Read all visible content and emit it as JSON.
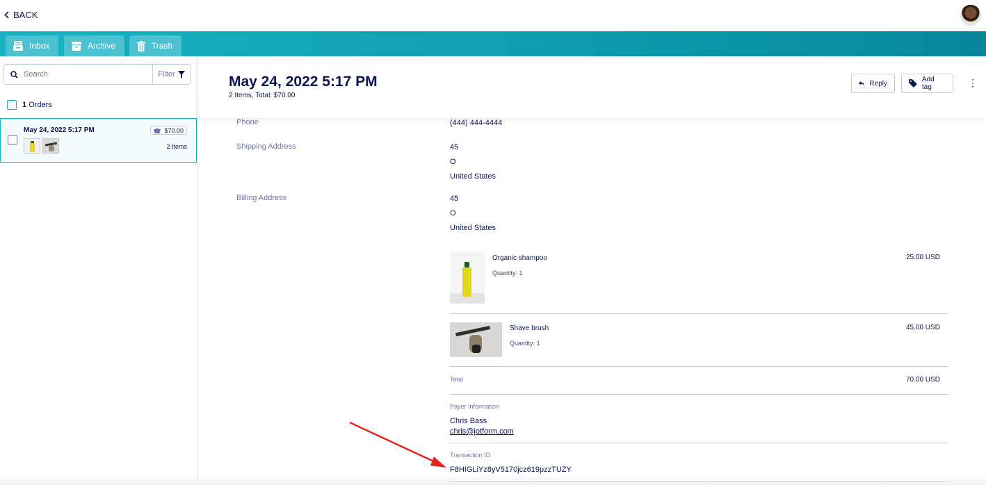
{
  "topbar": {
    "back_label": "BACK"
  },
  "tabs": [
    {
      "label": "Inbox"
    },
    {
      "label": "Archive"
    },
    {
      "label": "Trash"
    }
  ],
  "sidebar": {
    "search_placeholder": "Search",
    "filter_label": "Filter",
    "orders_count": "1",
    "orders_label": "Orders",
    "order": {
      "date": "May 24, 2022 5:17 PM",
      "price": "$70.00",
      "items": "2 Items"
    }
  },
  "header": {
    "title": "May 24, 2022 5:17 PM",
    "subtitle": "2 Items, Total: $70.00",
    "reply_label": "Reply",
    "add_tag_label": "Add tag",
    "more_label": "⋮"
  },
  "details": {
    "phone_label": "Phone",
    "phone_value": "(444) 444-4444",
    "shipping_label": "Shipping Address",
    "shipping_lines": [
      "45",
      "O",
      "United States"
    ],
    "billing_label": "Billing Address",
    "billing_lines": [
      "45",
      "O",
      "United States"
    ]
  },
  "products": [
    {
      "name": "Organic shampoo",
      "quantity": "Quantity: 1",
      "price": "25.00 USD"
    },
    {
      "name": "Shave brush",
      "quantity": "Quantity: 1",
      "price": "45.00 USD"
    }
  ],
  "total": {
    "label": "Total",
    "value": "70.00 USD"
  },
  "payer": {
    "label": "Payer Information",
    "name": "Chris Bass",
    "email": "chris@jotform.com"
  },
  "transaction": {
    "label": "Transaction ID",
    "value": "F8HIGLiYz8yV5170jcz619pzzTUZY"
  },
  "colors": {
    "accent": "#19b3c4",
    "text": "#0a1551",
    "muted": "#6f76a7",
    "annotation_arrow": "#e8231d"
  }
}
